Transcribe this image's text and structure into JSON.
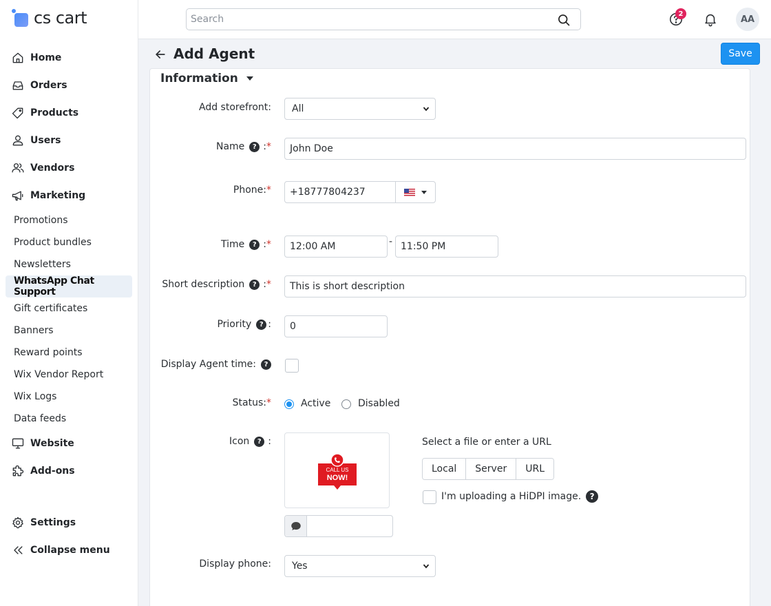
{
  "brand": {
    "name": "cs cart"
  },
  "search": {
    "placeholder": "Search"
  },
  "header": {
    "notifications_badge": "2",
    "avatar_initials": "AA"
  },
  "sidebar": {
    "main_top": [
      {
        "label": "Home",
        "icon": "home-icon"
      },
      {
        "label": "Orders",
        "icon": "inbox-icon"
      },
      {
        "label": "Products",
        "icon": "tag-icon"
      },
      {
        "label": "Users",
        "icon": "user-icon"
      },
      {
        "label": "Vendors",
        "icon": "users-icon"
      },
      {
        "label": "Marketing",
        "icon": "megaphone-icon"
      }
    ],
    "marketing_items": [
      "Promotions",
      "Product bundles",
      "Newsletters",
      "WhatsApp Chat Support",
      "Gift certificates",
      "Banners",
      "Reward points",
      "Wix Vendor Report",
      "Wix Logs",
      "Data feeds"
    ],
    "active_item": "WhatsApp Chat Support",
    "main_bottom": [
      {
        "label": "Website",
        "icon": "monitor-icon"
      },
      {
        "label": "Add-ons",
        "icon": "puzzle-icon"
      }
    ],
    "settings": "Settings",
    "collapse": "Collapse menu"
  },
  "page": {
    "title": "Add Agent",
    "save_label": "Save",
    "section_title": "Information"
  },
  "form": {
    "storefront": {
      "label": "Add storefront:",
      "value": "All"
    },
    "name": {
      "label": "Name",
      "value": "John Doe"
    },
    "phone": {
      "label": "Phone:",
      "value": "+18777804237",
      "country_flag": "us-flag-icon"
    },
    "time": {
      "label": "Time",
      "from": "12:00 AM",
      "to": "11:50 PM",
      "separator": "-"
    },
    "short_description": {
      "label": "Short description",
      "value": "This is short description"
    },
    "priority": {
      "label": "Priority",
      "value": "0"
    },
    "display_agent_time": {
      "label": "Display Agent time:",
      "checked": false
    },
    "status": {
      "label": "Status:",
      "options": [
        "Active",
        "Disabled"
      ],
      "selected": "Active"
    },
    "icon": {
      "label": "Icon",
      "image_text_top": "CALL US",
      "image_text_bottom": "NOW!",
      "file_prompt": "Select a file or enter a URL",
      "sources": [
        "Local",
        "Server",
        "URL"
      ],
      "hidpi_label": "I'm uploading a HiDPI image."
    },
    "display_phone": {
      "label": "Display phone:",
      "value": "Yes"
    }
  },
  "colors": {
    "accent": "#1d92f1",
    "badge": "#e0245e",
    "required": "#d0342c",
    "active_nav_bg": "#eaf0f7"
  }
}
